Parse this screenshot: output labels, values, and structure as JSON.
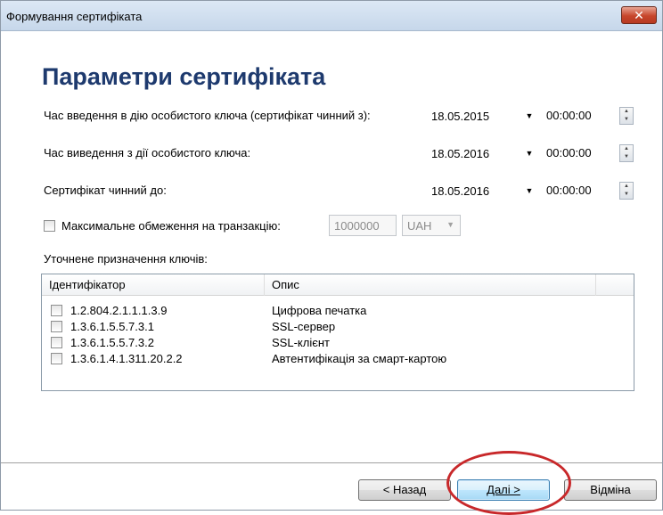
{
  "window": {
    "title": "Формування сертифіката",
    "close_glyph": "✕"
  },
  "heading": "Параметри сертифіката",
  "fields": {
    "validity_start": {
      "label": "Час введення в дію особистого ключа (сертифікат чинний з):",
      "date": "18.05.2015",
      "time": "00:00:00"
    },
    "key_expiry": {
      "label": "Час виведення з дії особистого ключа:",
      "date": "18.05.2016",
      "time": "00:00:00"
    },
    "cert_valid_until": {
      "label": "Сертифікат чинний до:",
      "date": "18.05.2016",
      "time": "00:00:00"
    }
  },
  "transaction_limit": {
    "label": "Максимальне обмеження на транзакцію:",
    "amount": "1000000",
    "currency": "UAH"
  },
  "key_usage": {
    "label": "Уточнене призначення ключів:",
    "columns": [
      "Ідентифікатор",
      "Опис"
    ],
    "rows": [
      {
        "id": "1.2.804.2.1.1.1.3.9",
        "desc": "Цифрова печатка"
      },
      {
        "id": "1.3.6.1.5.5.7.3.1",
        "desc": "SSL-сервер"
      },
      {
        "id": "1.3.6.1.5.5.7.3.2",
        "desc": "SSL-клієнт"
      },
      {
        "id": "1.3.6.1.4.1.311.20.2.2",
        "desc": "Автентифікація за смарт-картою"
      }
    ]
  },
  "buttons": {
    "back": "< Назад",
    "next": "Далі >",
    "cancel": "Відміна"
  },
  "colors": {
    "heading": "#1e3a6e",
    "annotation": "#c8282a"
  }
}
